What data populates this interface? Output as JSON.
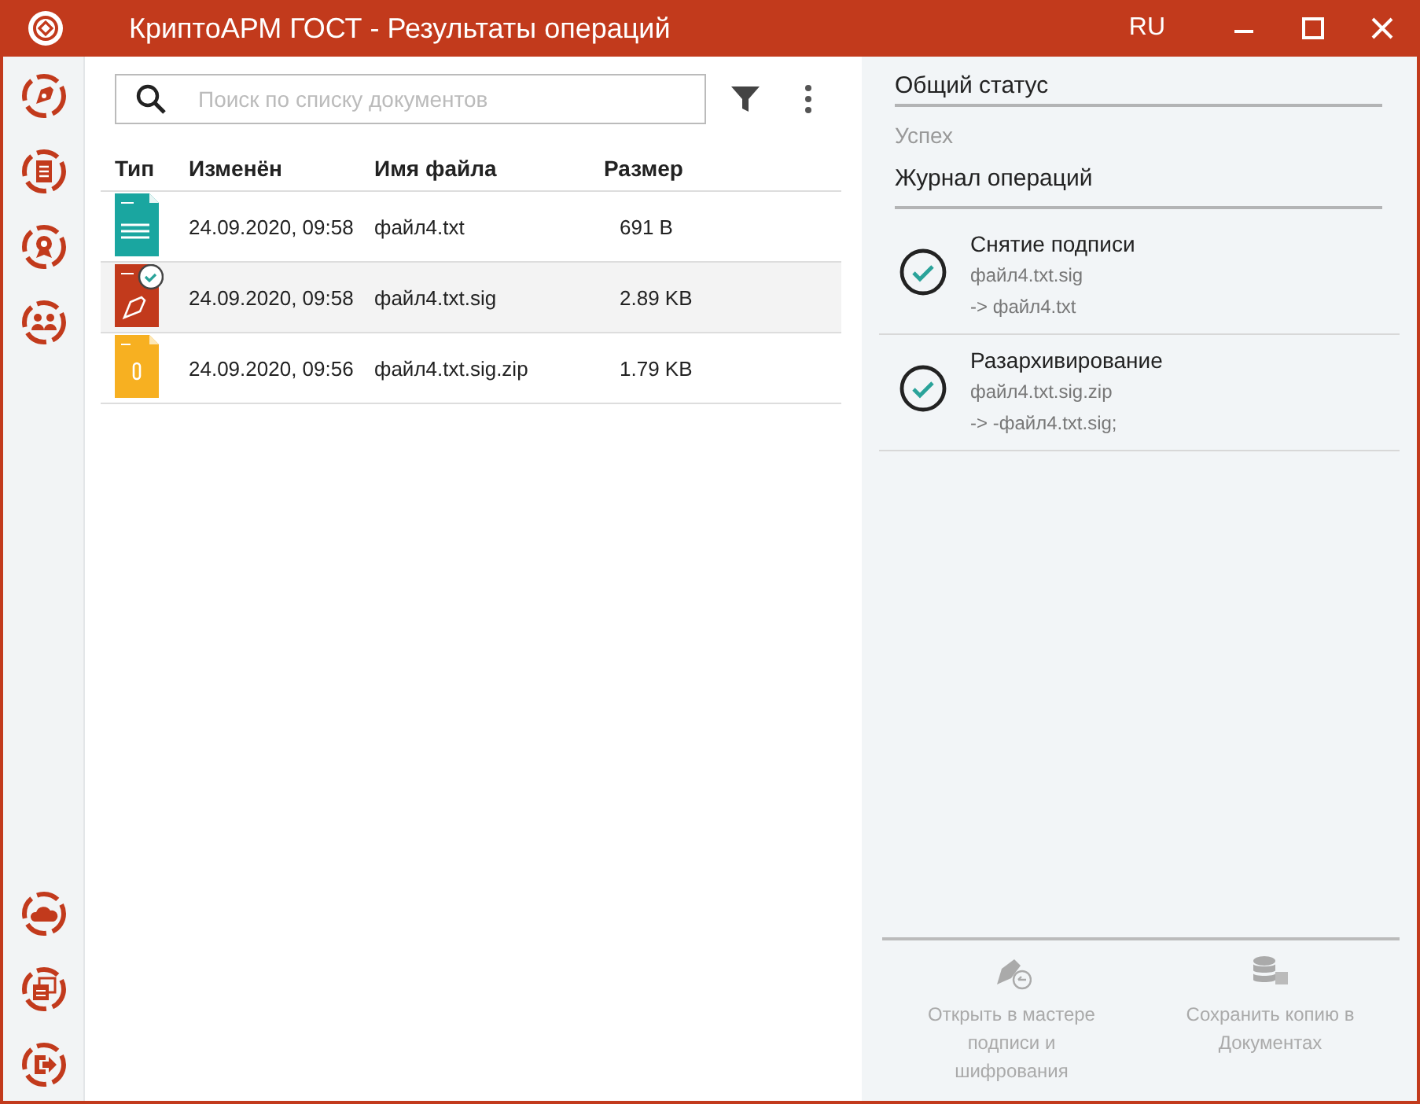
{
  "window": {
    "title": "КриптоАРМ ГОСТ - Результаты операций",
    "language": "RU"
  },
  "sidebar": {
    "top_items": [
      {
        "kind": "sign"
      },
      {
        "kind": "documents"
      },
      {
        "kind": "certificates"
      },
      {
        "kind": "contacts"
      }
    ],
    "bottom_items": [
      {
        "kind": "cloud"
      },
      {
        "kind": "windows"
      },
      {
        "kind": "exit"
      }
    ]
  },
  "search": {
    "placeholder": "Поиск по списку документов"
  },
  "table": {
    "columns": [
      "Тип",
      "Изменён",
      "Имя файла",
      "Размер"
    ],
    "rows": [
      {
        "kind": "txt",
        "modified": "24.09.2020, 09:58",
        "name": "файл4.txt",
        "size": "691 B",
        "selected": false
      },
      {
        "kind": "sig",
        "modified": "24.09.2020, 09:58",
        "name": "файл4.txt.sig",
        "size": "2.89 KB",
        "selected": true
      },
      {
        "kind": "zip",
        "modified": "24.09.2020, 09:56",
        "name": "файл4.txt.sig.zip",
        "size": "1.79 KB",
        "selected": false
      }
    ]
  },
  "status_panel": {
    "overall_title": "Общий статус",
    "overall_status": "Успех",
    "log_title": "Журнал операций",
    "operations": [
      {
        "title": "Снятие подписи",
        "source": "файл4.txt.sig",
        "result": "-> файл4.txt",
        "kind": "success"
      },
      {
        "title": "Разархивирование",
        "source": "файл4.txt.sig.zip",
        "result": "-> -файл4.txt.sig;",
        "kind": "success"
      }
    ],
    "actions": [
      {
        "kind": "open_wizard",
        "label": "Открыть в мастере подписи и шифрования",
        "disabled": true
      },
      {
        "kind": "save_copy",
        "label": "Сохранить копию в Документах",
        "disabled": true
      }
    ]
  }
}
